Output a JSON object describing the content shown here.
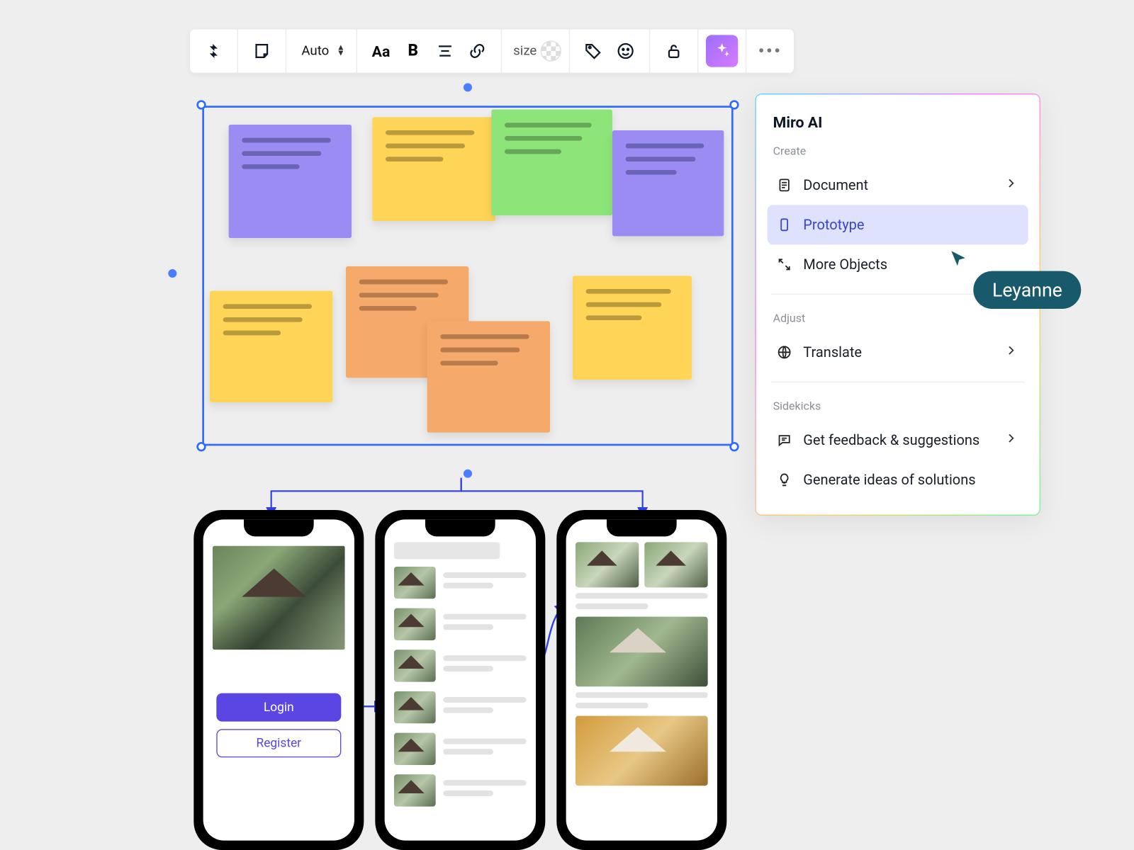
{
  "toolbar": {
    "auto_label": "Auto",
    "font_label": "Aa",
    "bold_label": "B",
    "size_label": "size"
  },
  "ai_panel": {
    "title": "Miro AI",
    "sections": {
      "create": "Create",
      "adjust": "Adjust",
      "sidekicks": "Sidekicks"
    },
    "items": {
      "document": "Document",
      "prototype": "Prototype",
      "more_objects": "More Objects",
      "translate": "Translate",
      "feedback": "Get feedback & suggestions",
      "generate_ideas": "Generate ideas of solutions"
    }
  },
  "cursor_user": "Leyanne",
  "phone1": {
    "login": "Login",
    "register": "Register"
  }
}
